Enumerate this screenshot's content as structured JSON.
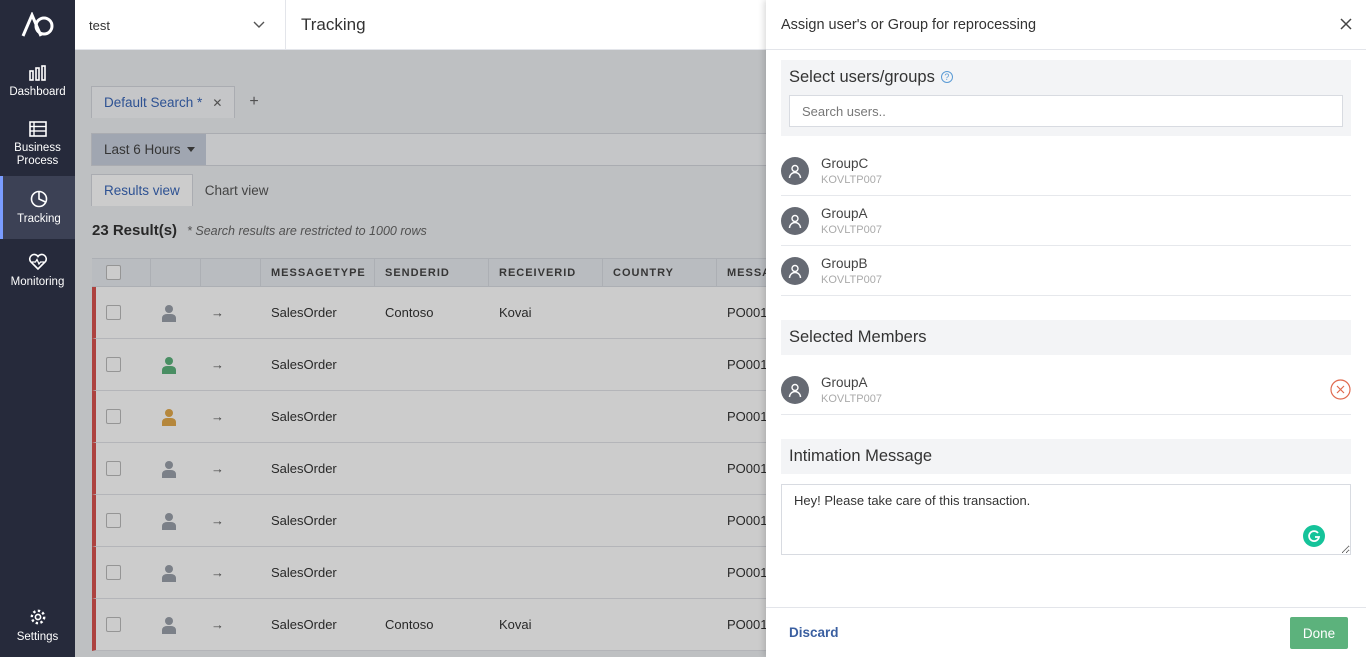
{
  "sidebar": {
    "items": [
      {
        "label": "Dashboard",
        "icon": "bar-chart-icon"
      },
      {
        "label": "Business\nProcess",
        "icon": "list-icon"
      },
      {
        "label": "Tracking",
        "icon": "pie-chart-icon",
        "active": true
      },
      {
        "label": "Monitoring",
        "icon": "heart-pulse-icon"
      }
    ],
    "settings_label": "Settings"
  },
  "topbar": {
    "environment": "test",
    "title": "Tracking"
  },
  "search": {
    "tab_label": "Default Search *",
    "time_filter": "Last 6 Hours"
  },
  "views": {
    "results": "Results view",
    "chart": "Chart view"
  },
  "results": {
    "count": "23 Result(s)",
    "note": "* Search results are restricted to 1000 rows"
  },
  "grid": {
    "columns": [
      "MESSAGETYPE",
      "SENDERID",
      "RECEIVERID",
      "COUNTRY",
      "MESSA"
    ],
    "rows": [
      {
        "user_color": "#9aa0aa",
        "type": "SalesOrder",
        "sender": "Contoso",
        "receiver": "Kovai",
        "country": "",
        "message": "PO001"
      },
      {
        "user_color": "#5cb27c",
        "type": "SalesOrder",
        "sender": "",
        "receiver": "",
        "country": "",
        "message": "PO001"
      },
      {
        "user_color": "#e3a94b",
        "type": "SalesOrder",
        "sender": "",
        "receiver": "",
        "country": "",
        "message": "PO001"
      },
      {
        "user_color": "#9aa0aa",
        "type": "SalesOrder",
        "sender": "",
        "receiver": "",
        "country": "",
        "message": "PO001"
      },
      {
        "user_color": "#9aa0aa",
        "type": "SalesOrder",
        "sender": "",
        "receiver": "",
        "country": "",
        "message": "PO001"
      },
      {
        "user_color": "#9aa0aa",
        "type": "SalesOrder",
        "sender": "",
        "receiver": "",
        "country": "",
        "message": "PO001"
      },
      {
        "user_color": "#9aa0aa",
        "type": "SalesOrder",
        "sender": "Contoso",
        "receiver": "Kovai",
        "country": "",
        "message": "PO001"
      }
    ]
  },
  "panel": {
    "title": "Assign user's or Group for reprocessing",
    "select_title": "Select users/groups",
    "search_placeholder": "Search users..",
    "users": [
      {
        "name": "GroupC",
        "sub": "KOVLTP007"
      },
      {
        "name": "GroupA",
        "sub": "KOVLTP007"
      },
      {
        "name": "GroupB",
        "sub": "KOVLTP007"
      }
    ],
    "selected_title": "Selected Members",
    "selected": [
      {
        "name": "GroupA",
        "sub": "KOVLTP007"
      }
    ],
    "message_title": "Intimation Message",
    "message": "Hey! Please take care of this transaction.",
    "discard": "Discard",
    "done": "Done"
  }
}
